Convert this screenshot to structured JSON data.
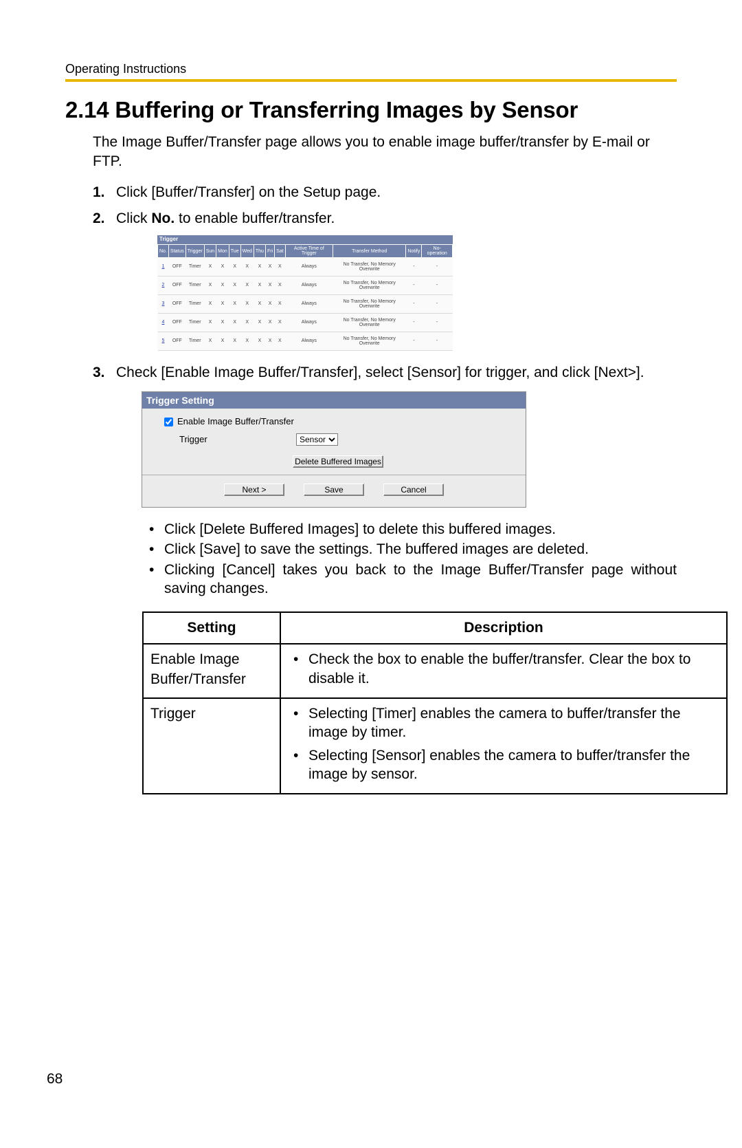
{
  "header_label": "Operating Instructions",
  "section_title": "2.14  Buffering or Transferring Images by Sensor",
  "intro": "The Image Buffer/Transfer page allows you to enable image buffer/transfer by E-mail or FTP.",
  "steps": {
    "s1": {
      "num": "1.",
      "text": "Click [Buffer/Transfer] on the Setup page."
    },
    "s2": {
      "num": "2.",
      "prefix": "Click ",
      "bold": "No.",
      "suffix": " to enable buffer/transfer."
    },
    "s3": {
      "num": "3.",
      "text": "Check [Enable Image Buffer/Transfer], select [Sensor] for trigger, and click [Next>]."
    }
  },
  "trigger_table": {
    "title": "Trigger",
    "headers": [
      "No.",
      "Status",
      "Trigger",
      "Sun",
      "Mon",
      "Tue",
      "Wed",
      "Thu",
      "Fri",
      "Sat",
      "Active Time of Trigger",
      "Transfer Method",
      "Notify",
      "No-operation"
    ],
    "rows": [
      {
        "no": "1",
        "status": "OFF",
        "trigger": "Timer",
        "days": [
          "X",
          "X",
          "X",
          "X",
          "X",
          "X",
          "X"
        ],
        "active": "Always",
        "tm": "No Transfer, No Memory Overwrite",
        "notify": "-",
        "noop": "-"
      },
      {
        "no": "2",
        "status": "OFF",
        "trigger": "Timer",
        "days": [
          "X",
          "X",
          "X",
          "X",
          "X",
          "X",
          "X"
        ],
        "active": "Always",
        "tm": "No Transfer, No Memory Overwrite",
        "notify": "-",
        "noop": "-"
      },
      {
        "no": "3",
        "status": "OFF",
        "trigger": "Timer",
        "days": [
          "X",
          "X",
          "X",
          "X",
          "X",
          "X",
          "X"
        ],
        "active": "Always",
        "tm": "No Transfer, No Memory Overwrite",
        "notify": "-",
        "noop": "-"
      },
      {
        "no": "4",
        "status": "OFF",
        "trigger": "Timer",
        "days": [
          "X",
          "X",
          "X",
          "X",
          "X",
          "X",
          "X"
        ],
        "active": "Always",
        "tm": "No Transfer, No Memory Overwrite",
        "notify": "-",
        "noop": "-"
      },
      {
        "no": "5",
        "status": "OFF",
        "trigger": "Timer",
        "days": [
          "X",
          "X",
          "X",
          "X",
          "X",
          "X",
          "X"
        ],
        "active": "Always",
        "tm": "No Transfer, No Memory Overwrite",
        "notify": "-",
        "noop": "-"
      }
    ]
  },
  "trigger_setting": {
    "title": "Trigger Setting",
    "checkbox_label": "Enable Image Buffer/Transfer",
    "trigger_label": "Trigger",
    "trigger_value": "Sensor",
    "delete_btn": "Delete Buffered Images",
    "next_btn": "Next >",
    "save_btn": "Save",
    "cancel_btn": "Cancel"
  },
  "sub_bullets": {
    "b1": "Click [Delete Buffered Images] to delete this buffered images.",
    "b2": "Click [Save] to save the settings. The buffered images are deleted.",
    "b3": "Clicking [Cancel] takes you back to the Image Buffer/Transfer page without saving changes."
  },
  "settings_table": {
    "h1": "Setting",
    "h2": "Description",
    "r1_setting": "Enable Image Buffer/Transfer",
    "r1_desc": "Check the box to enable the buffer/transfer. Clear the box to disable it.",
    "r2_setting": "Trigger",
    "r2_desc1": "Selecting [Timer] enables the camera to buffer/transfer the image by timer.",
    "r2_desc2": "Selecting [Sensor] enables the camera to buffer/transfer the image by sensor."
  },
  "page_number": "68"
}
